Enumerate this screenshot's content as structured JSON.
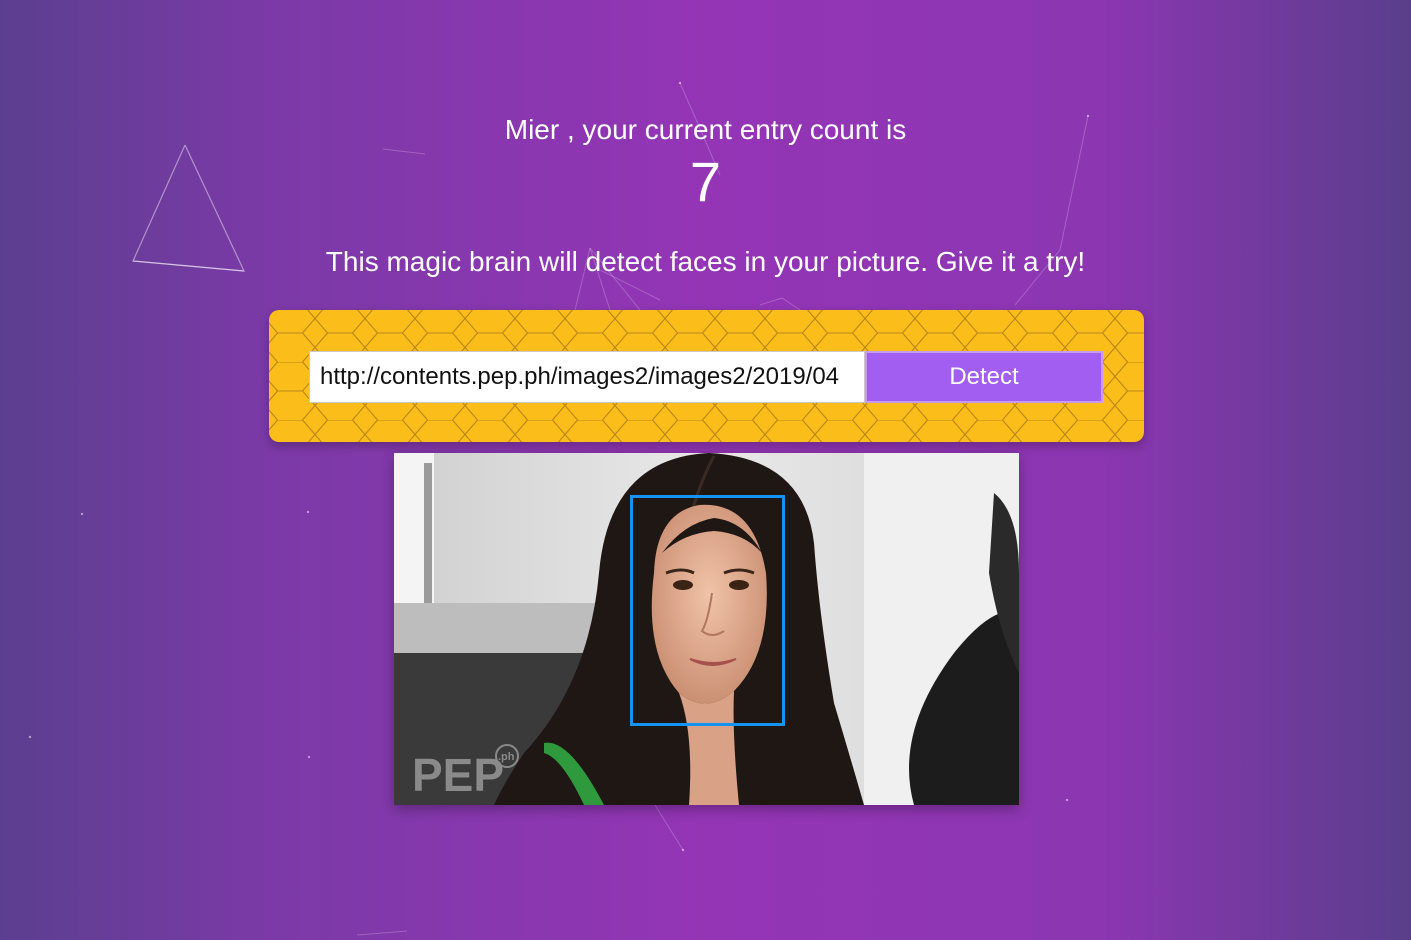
{
  "header": {
    "greeting": "Mier , your current entry count is",
    "entry_count": "7"
  },
  "tagline": "This magic brain will detect faces in your picture. Give it a try!",
  "form": {
    "url_value": "http://contents.pep.ph/images2/images2/2019/04",
    "detect_label": "Detect"
  },
  "image": {
    "watermark": "PEP",
    "watermark_suffix": ".ph"
  },
  "colors": {
    "accent_purple": "#a25ef0",
    "card_yellow": "#fbbd1a",
    "face_box": "#1494f0"
  },
  "icons": [
    "particles-background",
    "face-bounding-box"
  ]
}
